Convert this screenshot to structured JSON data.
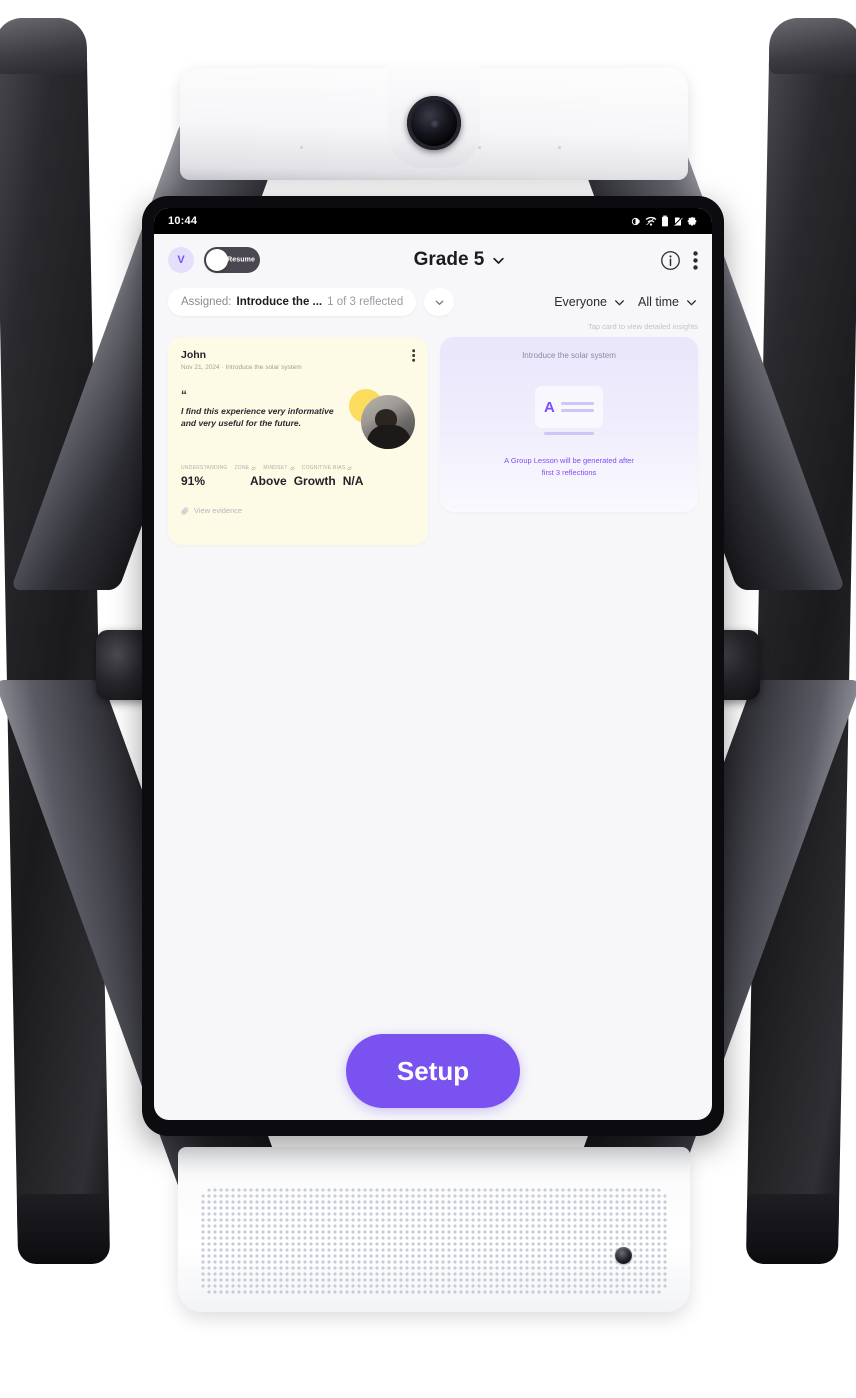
{
  "device": {
    "name": "classroom-robot-kiosk",
    "camera_icon": "camera-lens",
    "speaker_icon": "speaker-grille"
  },
  "status_bar": {
    "clock": "10:44",
    "icons": [
      "brightness-icon",
      "wifi-icon",
      "battery-icon",
      "sim-off-icon",
      "gear-icon"
    ]
  },
  "app_bar": {
    "avatar_initial": "V",
    "toggle": {
      "label": "Resume",
      "state": "off"
    },
    "title": "Grade 5",
    "title_chevron": "chevron-down-icon",
    "info_icon": "info-circle-icon",
    "more_icon": "kebab-menu-icon"
  },
  "filters": {
    "assigned_label": "Assigned:",
    "assigned_value": "Introduce the ...",
    "assigned_count": "1 of 3 reflected",
    "expand_icon": "chevron-down-icon",
    "audience": "Everyone",
    "time_range": "All time"
  },
  "hint": "Tap card to view detailed insights",
  "reflection_card": {
    "student_name": "John",
    "meta": "Nov 21, 2024  ·  Introduce the solar system",
    "kebab_icon": "kebab-menu-icon",
    "quote_mark": "“",
    "quote": "I find this experience very informative and very useful for the future.",
    "metrics": [
      {
        "label": "UNDERSTANDING",
        "value": "91%",
        "has_icon": false
      },
      {
        "label": "ZONE",
        "value": "Above",
        "has_icon": true
      },
      {
        "label": "MINDSET",
        "value": "Growth",
        "has_icon": true
      },
      {
        "label": "COGNITIVE BIAS",
        "value": "N/A",
        "has_icon": true
      }
    ],
    "evidence_label": "View evidence",
    "evidence_icon": "paperclip-icon",
    "card_color": "#fdfbe6"
  },
  "lesson_card": {
    "title": "Introduce the solar system",
    "doc_letter": "A",
    "note_line_1": "A Group Lesson will be generated after",
    "note_line_2": "first 3 reflections",
    "accent_color": "#7c4dff"
  },
  "setup_button": {
    "label": "Setup",
    "color": "#7a52f0"
  }
}
